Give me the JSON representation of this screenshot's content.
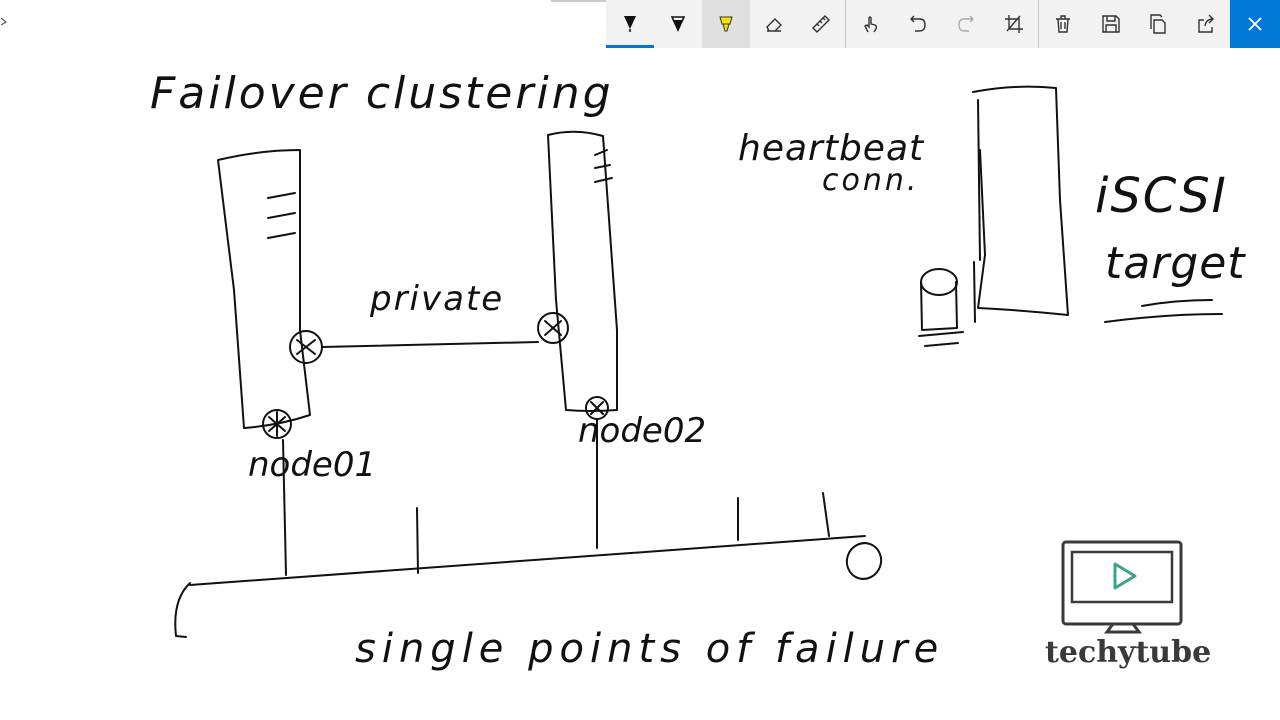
{
  "toolbar": {
    "buttons": [
      {
        "name": "ballpoint-pen",
        "color": "#000000"
      },
      {
        "name": "pencil",
        "color": "#000000"
      },
      {
        "name": "highlighter",
        "color": "#f5e10a"
      },
      {
        "name": "eraser"
      },
      {
        "name": "ruler"
      },
      {
        "name": "touch-writing"
      },
      {
        "name": "undo"
      },
      {
        "name": "redo"
      },
      {
        "name": "crop"
      },
      {
        "name": "delete"
      },
      {
        "name": "save"
      },
      {
        "name": "copy"
      },
      {
        "name": "share"
      },
      {
        "name": "close"
      }
    ],
    "accent": "#0078d7"
  },
  "drawing": {
    "title": "Failover clustering",
    "labels": {
      "heartbeat_line1": "heartbeat",
      "heartbeat_line2": "conn.",
      "iscsi_line1": "iSCSI",
      "iscsi_line2": "target",
      "private": "private",
      "node1": "node01",
      "node2": "node02",
      "spof": "single points of failure"
    },
    "ink_color": "#111111"
  },
  "logo": {
    "text": "techytube",
    "play_color": "#3aa38a"
  }
}
